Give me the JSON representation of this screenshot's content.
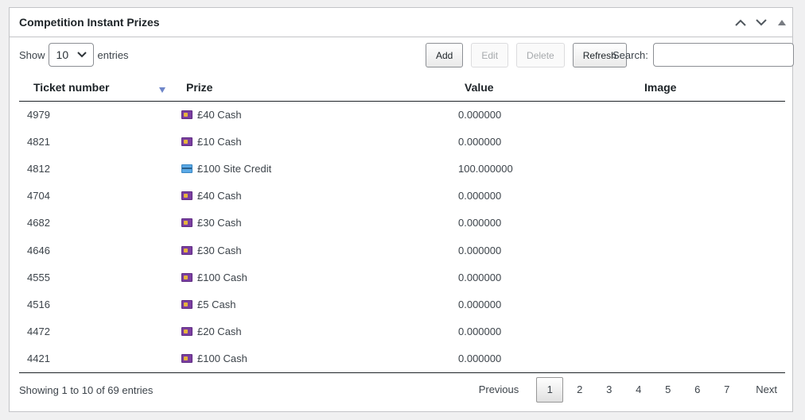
{
  "panel": {
    "title": "Competition Instant Prizes"
  },
  "toolbar": {
    "show_label": "Show",
    "length_value": "10",
    "entries_label": "entries",
    "add_label": "Add",
    "edit_label": "Edit",
    "delete_label": "Delete",
    "refresh_label": "Refresh",
    "search_label": "Search:",
    "search_value": ""
  },
  "table": {
    "headers": {
      "ticket": "Ticket number",
      "prize": "Prize",
      "value": "Value",
      "image": "Image"
    },
    "rows": [
      {
        "ticket": "4979",
        "icon": "cash-icon",
        "prize": "£40 Cash",
        "value": "0.000000",
        "image": ""
      },
      {
        "ticket": "4821",
        "icon": "cash-icon",
        "prize": "£10 Cash",
        "value": "0.000000",
        "image": ""
      },
      {
        "ticket": "4812",
        "icon": "credit-card-icon",
        "prize": "£100 Site Credit",
        "value": "100.000000",
        "image": ""
      },
      {
        "ticket": "4704",
        "icon": "cash-icon",
        "prize": "£40 Cash",
        "value": "0.000000",
        "image": ""
      },
      {
        "ticket": "4682",
        "icon": "cash-icon",
        "prize": "£30 Cash",
        "value": "0.000000",
        "image": ""
      },
      {
        "ticket": "4646",
        "icon": "cash-icon",
        "prize": "£30 Cash",
        "value": "0.000000",
        "image": ""
      },
      {
        "ticket": "4555",
        "icon": "cash-icon",
        "prize": "£100 Cash",
        "value": "0.000000",
        "image": ""
      },
      {
        "ticket": "4516",
        "icon": "cash-icon",
        "prize": "£5 Cash",
        "value": "0.000000",
        "image": ""
      },
      {
        "ticket": "4472",
        "icon": "cash-icon",
        "prize": "£20 Cash",
        "value": "0.000000",
        "image": ""
      },
      {
        "ticket": "4421",
        "icon": "cash-icon",
        "prize": "£100 Cash",
        "value": "0.000000",
        "image": ""
      }
    ]
  },
  "footer": {
    "info": "Showing 1 to 10 of 69 entries",
    "previous": "Previous",
    "next": "Next",
    "pages": [
      "1",
      "2",
      "3",
      "4",
      "5",
      "6",
      "7"
    ],
    "current_page": "1"
  },
  "colors": {
    "sort_indicator": "#6e86c9",
    "border": "#c3c4c7",
    "background": "#f0f0f1"
  }
}
